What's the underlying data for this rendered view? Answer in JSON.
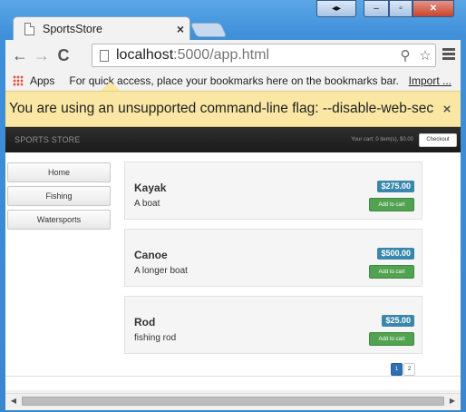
{
  "window": {
    "tab_title": "SportsStore",
    "tab_close": "×",
    "controls": {
      "ext": "◂▸",
      "min": "–",
      "max": "▫",
      "close": "✕"
    }
  },
  "toolbar": {
    "back_icon": "←",
    "forward_icon": "→",
    "reload_icon": "C",
    "url_host": "localhost",
    "url_rest": ":5000/app.html",
    "search_icon": "⚲",
    "star_icon": "☆"
  },
  "bookmarks": {
    "apps_label": "Apps",
    "hint": "For quick access, place your bookmarks here on the bookmarks bar.",
    "import_label": "Import ..."
  },
  "infobar": {
    "message": "You are using an unsupported command-line flag: --disable-web-security.",
    "close": "×"
  },
  "store": {
    "brand": "SPORTS STORE",
    "cart_summary": "Your cart: 0 item(s), $0.00",
    "checkout_label": "Checkout",
    "categories": [
      "Home",
      "Fishing",
      "Watersports"
    ],
    "products": [
      {
        "name": "Kayak",
        "description": "A boat",
        "price": "$275.00",
        "add_label": "Add to cart"
      },
      {
        "name": "Canoe",
        "description": "A longer boat",
        "price": "$500.00",
        "add_label": "Add to cart"
      },
      {
        "name": "Rod",
        "description": "fishing rod",
        "price": "$25.00",
        "add_label": "Add to cart"
      }
    ],
    "pages": [
      "1",
      "2"
    ],
    "active_page": "1"
  },
  "scrollbar": {
    "left_arrow": "◀",
    "right_arrow": "▶"
  }
}
